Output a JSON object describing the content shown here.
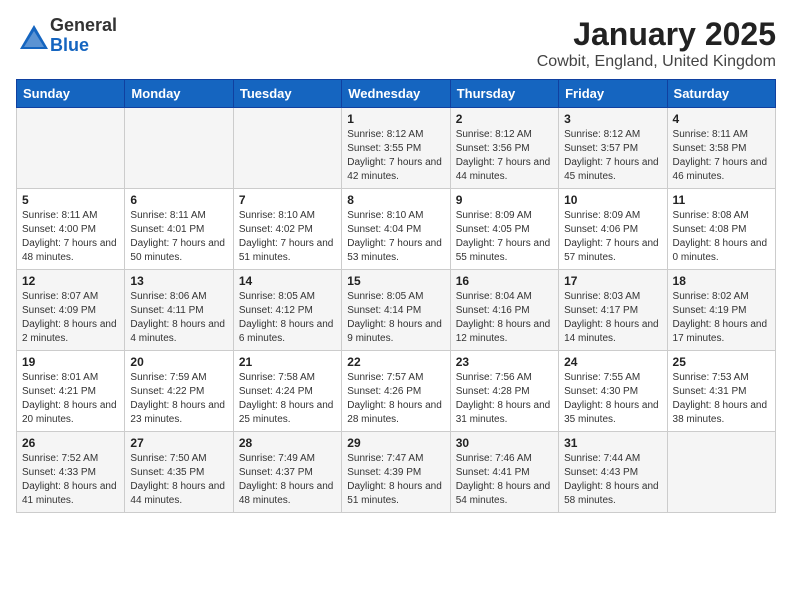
{
  "header": {
    "logo_general": "General",
    "logo_blue": "Blue",
    "title": "January 2025",
    "subtitle": "Cowbit, England, United Kingdom"
  },
  "days_of_week": [
    "Sunday",
    "Monday",
    "Tuesday",
    "Wednesday",
    "Thursday",
    "Friday",
    "Saturday"
  ],
  "weeks": [
    [
      {
        "day": "",
        "info": ""
      },
      {
        "day": "",
        "info": ""
      },
      {
        "day": "",
        "info": ""
      },
      {
        "day": "1",
        "info": "Sunrise: 8:12 AM\nSunset: 3:55 PM\nDaylight: 7 hours and 42 minutes."
      },
      {
        "day": "2",
        "info": "Sunrise: 8:12 AM\nSunset: 3:56 PM\nDaylight: 7 hours and 44 minutes."
      },
      {
        "day": "3",
        "info": "Sunrise: 8:12 AM\nSunset: 3:57 PM\nDaylight: 7 hours and 45 minutes."
      },
      {
        "day": "4",
        "info": "Sunrise: 8:11 AM\nSunset: 3:58 PM\nDaylight: 7 hours and 46 minutes."
      }
    ],
    [
      {
        "day": "5",
        "info": "Sunrise: 8:11 AM\nSunset: 4:00 PM\nDaylight: 7 hours and 48 minutes."
      },
      {
        "day": "6",
        "info": "Sunrise: 8:11 AM\nSunset: 4:01 PM\nDaylight: 7 hours and 50 minutes."
      },
      {
        "day": "7",
        "info": "Sunrise: 8:10 AM\nSunset: 4:02 PM\nDaylight: 7 hours and 51 minutes."
      },
      {
        "day": "8",
        "info": "Sunrise: 8:10 AM\nSunset: 4:04 PM\nDaylight: 7 hours and 53 minutes."
      },
      {
        "day": "9",
        "info": "Sunrise: 8:09 AM\nSunset: 4:05 PM\nDaylight: 7 hours and 55 minutes."
      },
      {
        "day": "10",
        "info": "Sunrise: 8:09 AM\nSunset: 4:06 PM\nDaylight: 7 hours and 57 minutes."
      },
      {
        "day": "11",
        "info": "Sunrise: 8:08 AM\nSunset: 4:08 PM\nDaylight: 8 hours and 0 minutes."
      }
    ],
    [
      {
        "day": "12",
        "info": "Sunrise: 8:07 AM\nSunset: 4:09 PM\nDaylight: 8 hours and 2 minutes."
      },
      {
        "day": "13",
        "info": "Sunrise: 8:06 AM\nSunset: 4:11 PM\nDaylight: 8 hours and 4 minutes."
      },
      {
        "day": "14",
        "info": "Sunrise: 8:05 AM\nSunset: 4:12 PM\nDaylight: 8 hours and 6 minutes."
      },
      {
        "day": "15",
        "info": "Sunrise: 8:05 AM\nSunset: 4:14 PM\nDaylight: 8 hours and 9 minutes."
      },
      {
        "day": "16",
        "info": "Sunrise: 8:04 AM\nSunset: 4:16 PM\nDaylight: 8 hours and 12 minutes."
      },
      {
        "day": "17",
        "info": "Sunrise: 8:03 AM\nSunset: 4:17 PM\nDaylight: 8 hours and 14 minutes."
      },
      {
        "day": "18",
        "info": "Sunrise: 8:02 AM\nSunset: 4:19 PM\nDaylight: 8 hours and 17 minutes."
      }
    ],
    [
      {
        "day": "19",
        "info": "Sunrise: 8:01 AM\nSunset: 4:21 PM\nDaylight: 8 hours and 20 minutes."
      },
      {
        "day": "20",
        "info": "Sunrise: 7:59 AM\nSunset: 4:22 PM\nDaylight: 8 hours and 23 minutes."
      },
      {
        "day": "21",
        "info": "Sunrise: 7:58 AM\nSunset: 4:24 PM\nDaylight: 8 hours and 25 minutes."
      },
      {
        "day": "22",
        "info": "Sunrise: 7:57 AM\nSunset: 4:26 PM\nDaylight: 8 hours and 28 minutes."
      },
      {
        "day": "23",
        "info": "Sunrise: 7:56 AM\nSunset: 4:28 PM\nDaylight: 8 hours and 31 minutes."
      },
      {
        "day": "24",
        "info": "Sunrise: 7:55 AM\nSunset: 4:30 PM\nDaylight: 8 hours and 35 minutes."
      },
      {
        "day": "25",
        "info": "Sunrise: 7:53 AM\nSunset: 4:31 PM\nDaylight: 8 hours and 38 minutes."
      }
    ],
    [
      {
        "day": "26",
        "info": "Sunrise: 7:52 AM\nSunset: 4:33 PM\nDaylight: 8 hours and 41 minutes."
      },
      {
        "day": "27",
        "info": "Sunrise: 7:50 AM\nSunset: 4:35 PM\nDaylight: 8 hours and 44 minutes."
      },
      {
        "day": "28",
        "info": "Sunrise: 7:49 AM\nSunset: 4:37 PM\nDaylight: 8 hours and 48 minutes."
      },
      {
        "day": "29",
        "info": "Sunrise: 7:47 AM\nSunset: 4:39 PM\nDaylight: 8 hours and 51 minutes."
      },
      {
        "day": "30",
        "info": "Sunrise: 7:46 AM\nSunset: 4:41 PM\nDaylight: 8 hours and 54 minutes."
      },
      {
        "day": "31",
        "info": "Sunrise: 7:44 AM\nSunset: 4:43 PM\nDaylight: 8 hours and 58 minutes."
      },
      {
        "day": "",
        "info": ""
      }
    ]
  ]
}
